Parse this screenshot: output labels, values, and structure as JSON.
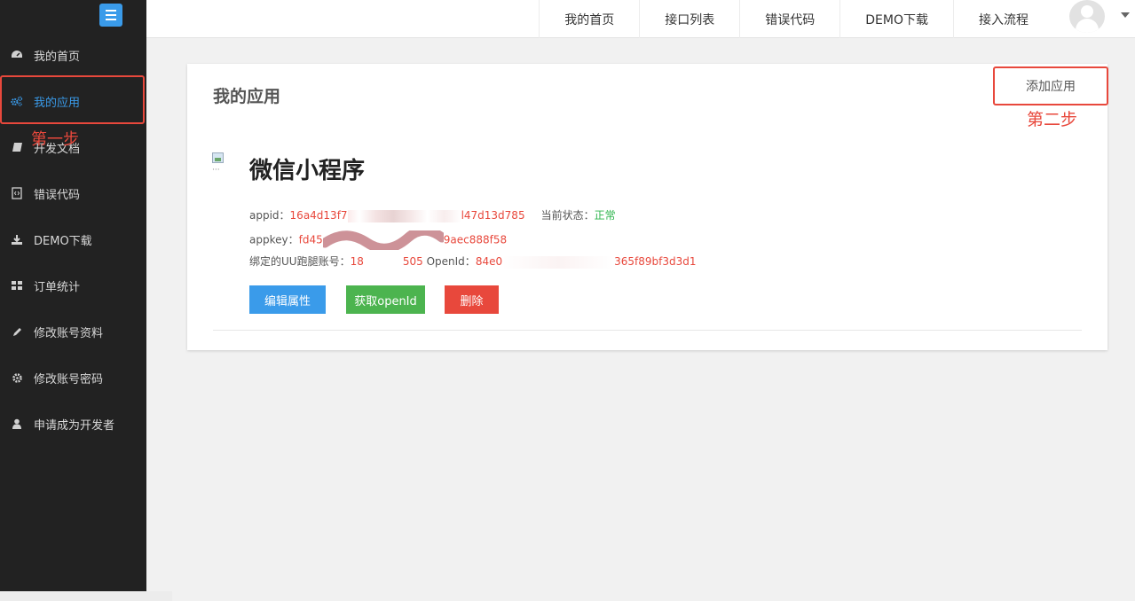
{
  "sidebar": {
    "items": [
      {
        "label": "我的首页",
        "icon": "dashboard-icon"
      },
      {
        "label": "我的应用",
        "icon": "gears-icon",
        "active": true
      },
      {
        "label": "开发文档",
        "icon": "book-icon"
      },
      {
        "label": "错误代码",
        "icon": "code-file-icon"
      },
      {
        "label": "DEMO下载",
        "icon": "download-icon"
      },
      {
        "label": "订单统计",
        "icon": "grid-icon"
      },
      {
        "label": "修改账号资料",
        "icon": "pencil-icon"
      },
      {
        "label": "修改账号密码",
        "icon": "gear-icon"
      },
      {
        "label": "申请成为开发者",
        "icon": "user-icon"
      }
    ],
    "active_color": "#3a9bea"
  },
  "topnav": {
    "links": [
      "我的首页",
      "接口列表",
      "错误代码",
      "DEMO下载",
      "接入流程"
    ]
  },
  "panel": {
    "title": "我的应用",
    "add_button": "添加应用"
  },
  "app": {
    "name": "微信小程序",
    "appid_label": "appid：",
    "appid_prefix": "16a4d13f7",
    "appid_suffix": "l47d13d785",
    "status_label": "当前状态：",
    "status_value": "正常",
    "appkey_label": "appkey：",
    "appkey_prefix": "fd45",
    "appkey_suffix": "9aec888f58",
    "bound_label": "绑定的UU跑腿账号：",
    "bound_prefix": "18",
    "bound_suffix": "505",
    "openid_label": "OpenId：",
    "openid_prefix": "84e0",
    "openid_suffix": "365f89bf3d3d1"
  },
  "buttons": {
    "edit": "编辑属性",
    "openid": "获取openId",
    "delete": "删除"
  },
  "annotations": {
    "step1": "第一步",
    "step2": "第二步"
  },
  "colors": {
    "red": "#e8483c",
    "green": "#4cb44f",
    "blue": "#3a9bea",
    "sidebar": "#222222"
  }
}
